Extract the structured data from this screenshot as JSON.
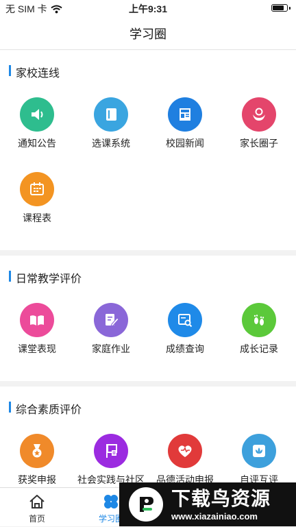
{
  "status_bar": {
    "carrier": "无 SIM 卡",
    "time": "上午9:31",
    "battery_level": 0.85
  },
  "nav": {
    "title": "学习圈"
  },
  "sections": [
    {
      "title": "家校连线",
      "items": [
        {
          "label": "通知公告",
          "icon": "speaker-icon",
          "color": "#2ebd8e"
        },
        {
          "label": "选课系统",
          "icon": "book-icon",
          "color": "#3aa5e0"
        },
        {
          "label": "校园新闻",
          "icon": "newspaper-icon",
          "color": "#1f7fe0"
        },
        {
          "label": "家长圈子",
          "icon": "parent-icon",
          "color": "#e4456b"
        },
        {
          "label": "课程表",
          "icon": "calendar-icon",
          "color": "#f39422"
        }
      ]
    },
    {
      "title": "日常教学评价",
      "items": [
        {
          "label": "课堂表现",
          "icon": "open-book-icon",
          "color": "#ec4b9a"
        },
        {
          "label": "家庭作业",
          "icon": "homework-icon",
          "color": "#8a67d8"
        },
        {
          "label": "成绩查询",
          "icon": "grade-search-icon",
          "color": "#1f8ae8"
        },
        {
          "label": "成长记录",
          "icon": "footprints-icon",
          "color": "#5bc93a"
        }
      ]
    },
    {
      "title": "综合素质评价",
      "items": [
        {
          "label": "获奖申报",
          "icon": "medal-icon",
          "color": "#f08a2a"
        },
        {
          "label": "社会实践与社区服务申报",
          "icon": "flag-icon",
          "color": "#9b2be0"
        },
        {
          "label": "品德活动申报",
          "icon": "heart-icon",
          "color": "#e13a3a"
        },
        {
          "label": "自评互评",
          "icon": "lotus-icon",
          "color": "#3da0dc"
        }
      ]
    }
  ],
  "tab_bar": [
    {
      "label": "首页",
      "icon": "home-icon"
    },
    {
      "label": "学习圈",
      "icon": "clover-icon",
      "active": true
    }
  ],
  "watermark": {
    "title": "下载鸟资源",
    "url": "www.xiazainiao.com"
  }
}
